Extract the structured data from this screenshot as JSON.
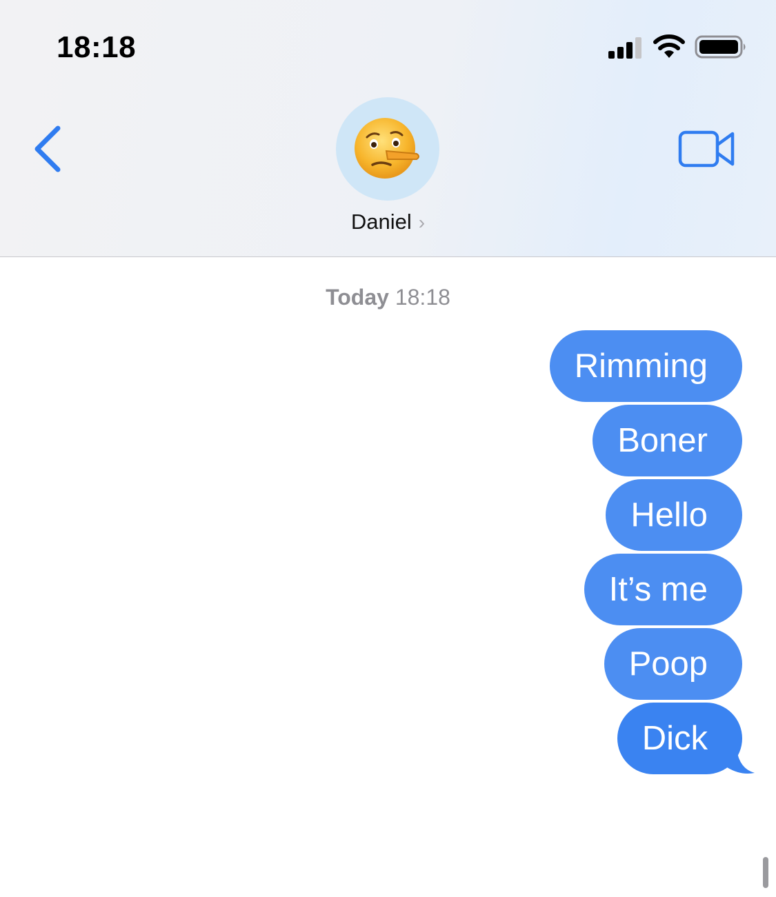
{
  "status_bar": {
    "time": "18:18"
  },
  "header": {
    "contact_name": "Daniel",
    "avatar_icon": "lying-face-emoji-icon",
    "accent_color": "#2f7cf0"
  },
  "conversation": {
    "timestamp_day": "Today",
    "timestamp_time": "18:18",
    "messages": [
      {
        "text": "Rimming",
        "sender": "me"
      },
      {
        "text": "Boner",
        "sender": "me"
      },
      {
        "text": "Hello",
        "sender": "me"
      },
      {
        "text": "It’s me",
        "sender": "me"
      },
      {
        "text": "Poop",
        "sender": "me"
      },
      {
        "text": "Dick",
        "sender": "me"
      }
    ],
    "bubble_color": "#4c8ef2"
  }
}
